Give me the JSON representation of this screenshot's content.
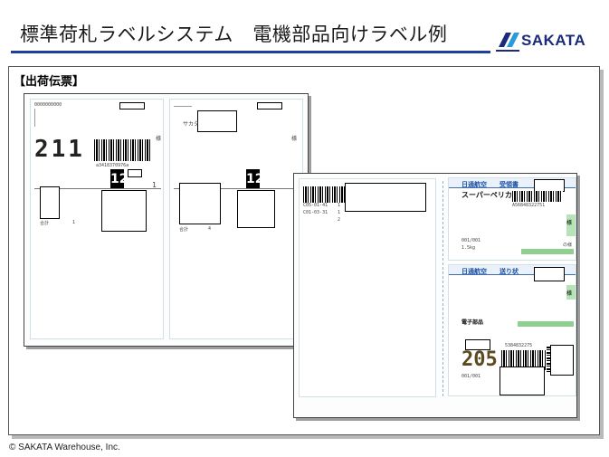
{
  "header": {
    "title": "標準荷札ラベルシステム　電機部品向けラベル例",
    "logo_text": "SAKATA"
  },
  "content": {
    "label": "【出荷伝票】"
  },
  "sheet1": {
    "left_label": {
      "top_code": "0000000000",
      "route_number": "211",
      "barcode_caption": "a3418370976a",
      "box_number": "12",
      "qty": "1",
      "side_text": "様",
      "total_label": "合計",
      "total_value": "1"
    },
    "right_label": {
      "company_short": "サカタ",
      "box_number": "12",
      "side_text": "様",
      "total_label": "合計",
      "total_value": "4"
    }
  },
  "sheet2": {
    "codes": [
      "C05-01-41",
      "C01-03-31"
    ],
    "code_qty": [
      "1",
      "1"
    ],
    "code_total": "2",
    "nittsu_top": {
      "brand": "日通航空",
      "doc_type": "受領書",
      "service": "スーパーペリカン",
      "tracking": "A56848322751",
      "count": "001/001",
      "weight": "1.5kg",
      "sama": "様",
      "sama2": "の様"
    },
    "nittsu_bottom": {
      "brand": "日通航空",
      "doc_type": "送り状",
      "content": "電子部品",
      "tracking": "5384832275",
      "route_code": "205",
      "count": "001/001",
      "sama": "様"
    }
  },
  "footer": {
    "copyright": "© SAKATA Warehouse, Inc."
  }
}
